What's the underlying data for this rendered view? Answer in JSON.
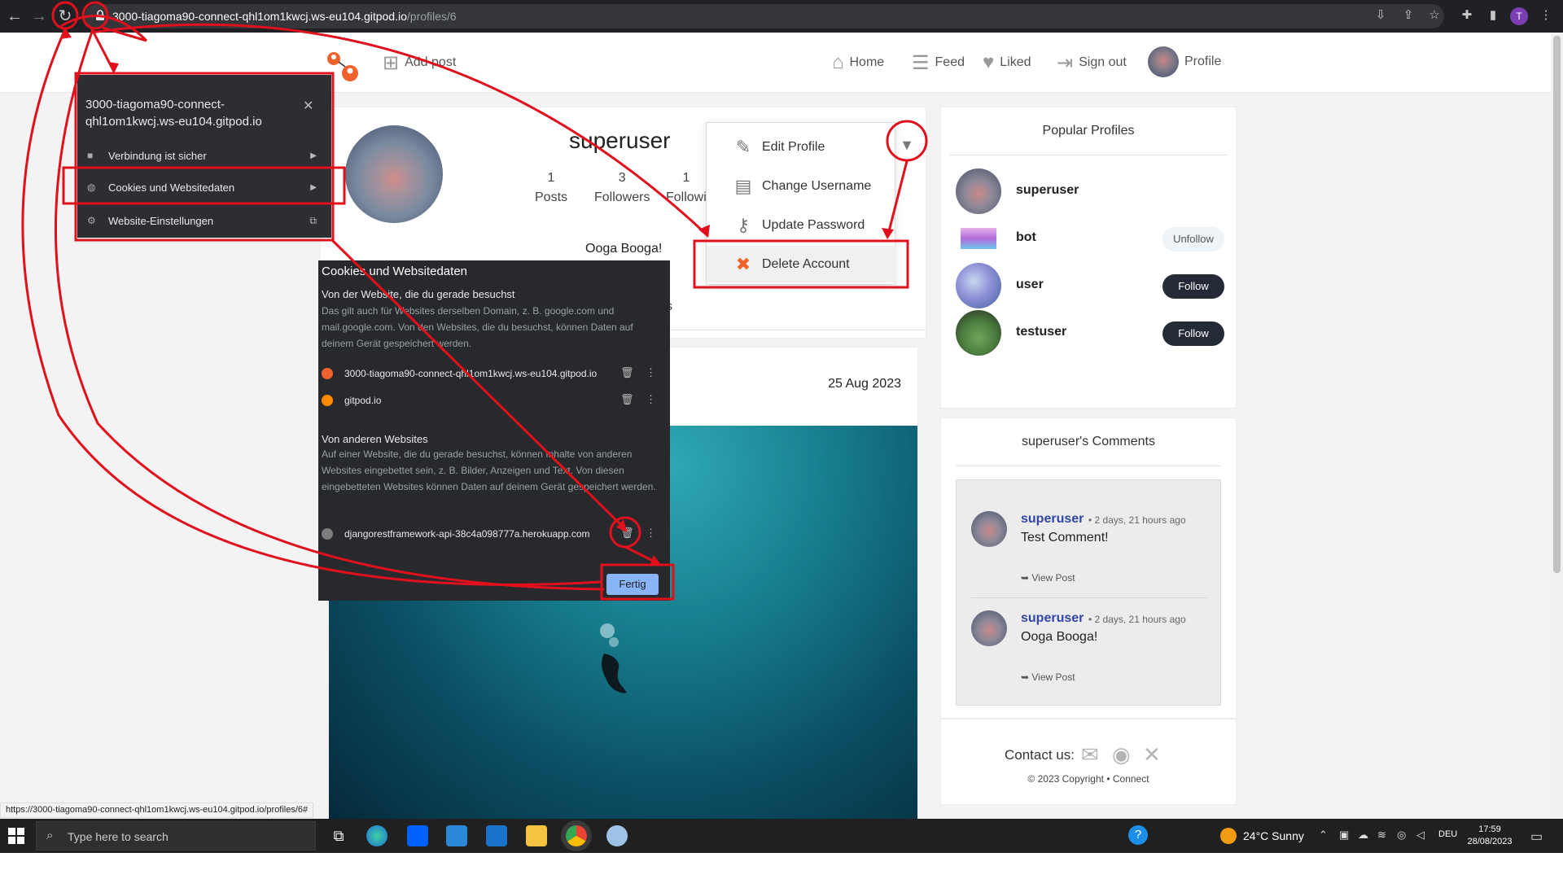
{
  "browser": {
    "url_host": "3000-tiagoma90-connect-qhl1om1kwcj.ws-eu104.gitpod.io",
    "url_path": "/profiles/6",
    "profile_letter": "T"
  },
  "header": {
    "add_post": "Add post",
    "nav": {
      "home": "Home",
      "feed": "Feed",
      "liked": "Liked",
      "sign_out": "Sign out",
      "profile": "Profile"
    }
  },
  "profile": {
    "username": "superuser",
    "posts_count": "1",
    "posts_label": "Posts",
    "followers_count": "3",
    "followers_label": "Followers",
    "following_count": "1",
    "following_label": "Followi",
    "bio": "Ooga Booga!",
    "tab_fragment": "s"
  },
  "profile_menu": {
    "edit_profile": "Edit Profile",
    "change_username": "Change Username",
    "update_password": "Update Password",
    "delete_account": "Delete Account"
  },
  "post": {
    "date": "25 Aug 2023"
  },
  "popular_profiles": {
    "title": "Popular Profiles",
    "items": [
      {
        "name": "superuser",
        "button": ""
      },
      {
        "name": "bot",
        "button": "Unfollow"
      },
      {
        "name": "user",
        "button": "Follow"
      },
      {
        "name": "testuser",
        "button": "Follow"
      }
    ]
  },
  "comments": {
    "title": "superuser's Comments",
    "items": [
      {
        "author": "superuser",
        "time": "• 2 days, 21 hours ago",
        "text": "Test Comment!",
        "link": "➥ View Post"
      },
      {
        "author": "superuser",
        "time": "• 2 days, 21 hours ago",
        "text": "Ooga Booga!",
        "link": "➥ View Post"
      }
    ]
  },
  "footer": {
    "contact": "Contact us:",
    "copyright": "© 2023 Copyright • Connect"
  },
  "site_info": {
    "host": "3000-tiagoma90-connect-qhl1om1kwcj.ws-eu104.gitpod.io",
    "secure": "Verbindung ist sicher",
    "cookies": "Cookies und Websitedaten",
    "settings": "Website-Einstellungen"
  },
  "cookies_dialog": {
    "title": "Cookies und Websitedaten",
    "current_heading": "Von der Website, die du gerade besuchst",
    "current_desc": "Das gilt auch für Websites derselben Domain, z. B. google.com und mail.google.com. Von den Websites, die du besuchst, können Daten auf deinem Gerät gespeichert werden.",
    "current_sites": [
      "3000-tiagoma90-connect-qhl1om1kwcj.ws-eu104.gitpod.io",
      "gitpod.io"
    ],
    "other_heading": "Von anderen Websites",
    "other_desc": "Auf einer Website, die du gerade besuchst, können Inhalte von anderen Websites eingebettet sein, z. B. Bilder, Anzeigen und Text. Von diesen eingebetteten Websites können Daten auf deinem Gerät gespeichert werden.",
    "other_sites": [
      "djangorestframework-api-38c4a098777a.herokuapp.com"
    ],
    "done": "Fertig"
  },
  "status_url": "https://3000-tiagoma90-connect-qhl1om1kwcj.ws-eu104.gitpod.io/profiles/6#",
  "taskbar": {
    "search_placeholder": "Type here to search",
    "weather": "24°C  Sunny",
    "lang": "DEU",
    "time": "17:59",
    "date": "28/08/2023"
  },
  "colors": {
    "annotation": "#e0101c",
    "accent_orange": "#f0622c",
    "button_dark": "#252a37",
    "link_blue": "#2f47a8"
  }
}
